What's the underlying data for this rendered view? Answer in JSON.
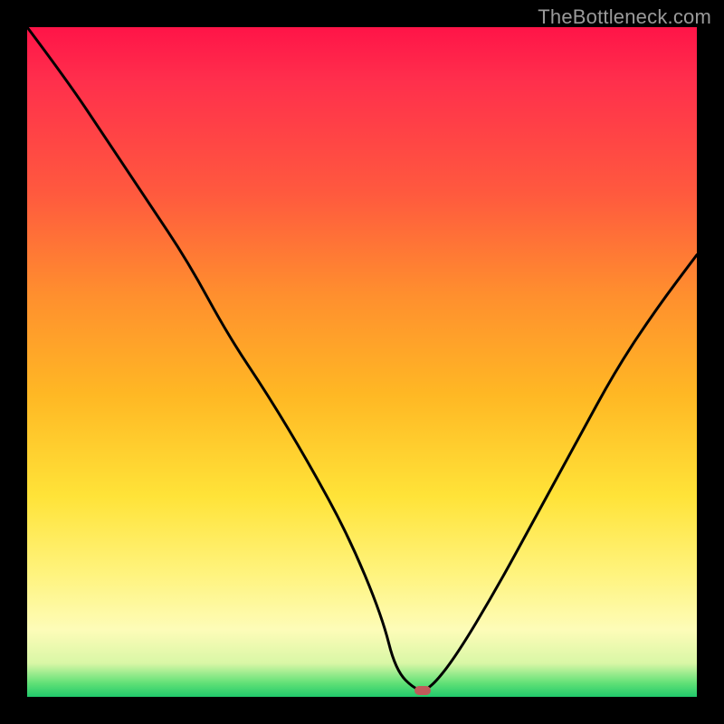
{
  "watermark": "TheBottleneck.com",
  "chart_data": {
    "type": "line",
    "title": "",
    "xlabel": "",
    "ylabel": "",
    "xlim": [
      0,
      100
    ],
    "ylim": [
      0,
      100
    ],
    "series": [
      {
        "name": "bottleneck-curve",
        "x": [
          0,
          6,
          12,
          18,
          24,
          30,
          36,
          42,
          48,
          53,
          55,
          58,
          60,
          64,
          70,
          76,
          82,
          88,
          94,
          100
        ],
        "values": [
          100,
          92,
          83,
          74,
          65,
          54,
          45,
          35,
          24,
          12,
          4,
          1,
          1,
          6,
          16,
          27,
          38,
          49,
          58,
          66
        ]
      }
    ],
    "marker": {
      "x": 59,
      "y": 1
    },
    "gradient_stops": [
      {
        "pos": 0,
        "color": "#ff1448"
      },
      {
        "pos": 25,
        "color": "#ff5a3e"
      },
      {
        "pos": 55,
        "color": "#ffb824"
      },
      {
        "pos": 82,
        "color": "#fff480"
      },
      {
        "pos": 98,
        "color": "#5fe076"
      },
      {
        "pos": 100,
        "color": "#21c96b"
      }
    ]
  }
}
